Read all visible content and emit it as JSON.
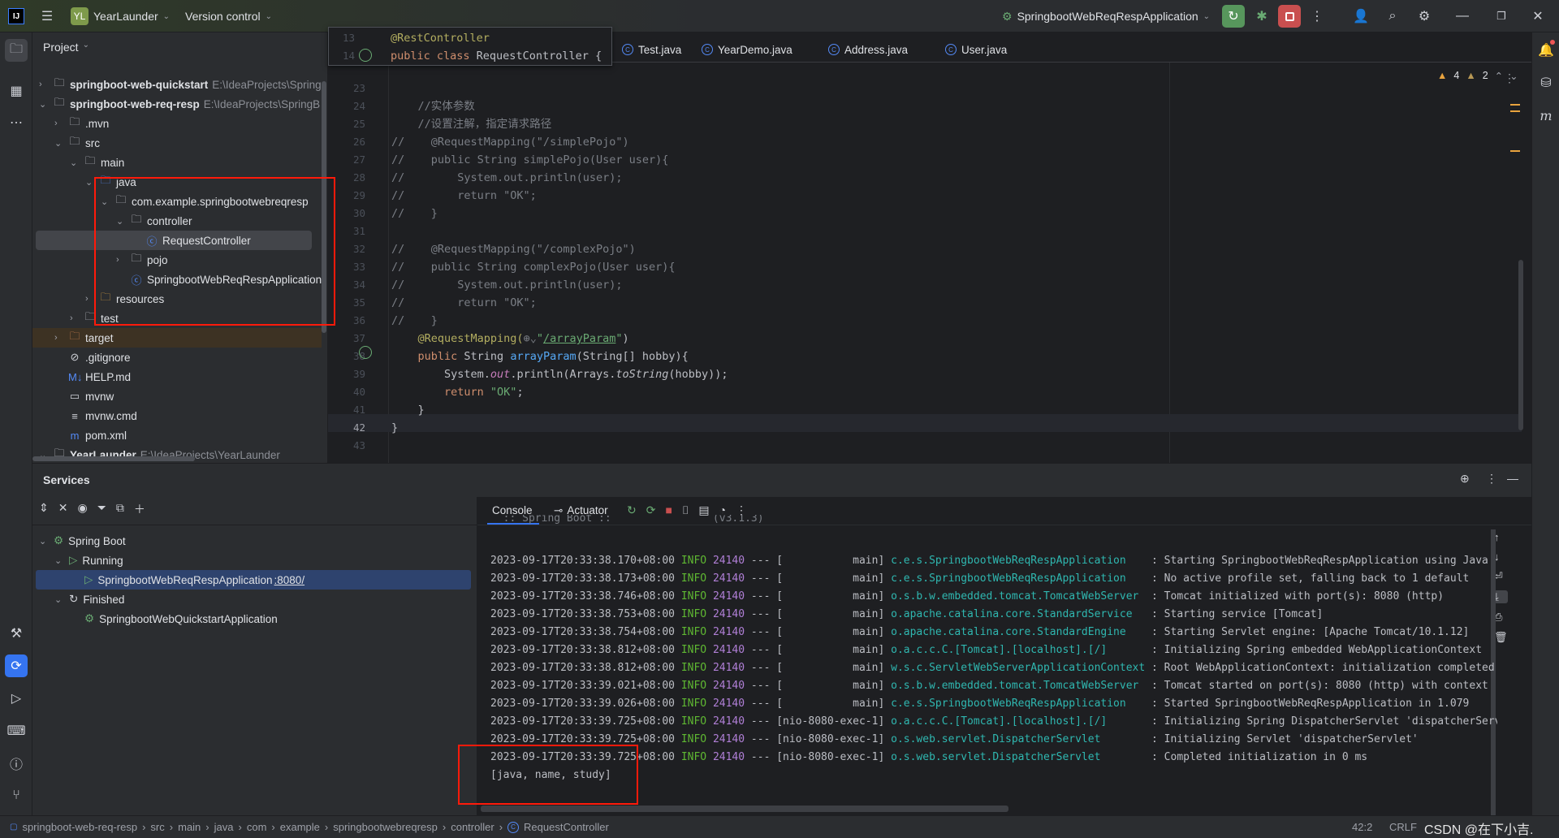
{
  "titlebar": {
    "project_badge": "YL",
    "project": "YearLaunder",
    "vcs": "Version control",
    "run_config": "SpringbootWebReqRespApplication"
  },
  "project_panel": {
    "title": "Project",
    "items": [
      {
        "label": "springboot-web-quickstart",
        "hint": "E:\\IdeaProjects\\Spring",
        "depth": 0,
        "chev": "›",
        "icon": "module",
        "bold": true
      },
      {
        "label": "springboot-web-req-resp",
        "hint": "E:\\IdeaProjects\\SpringB",
        "depth": 0,
        "chev": "⌄",
        "icon": "module",
        "bold": true
      },
      {
        "label": ".mvn",
        "depth": 1,
        "chev": "›",
        "icon": "folder"
      },
      {
        "label": "src",
        "depth": 1,
        "chev": "⌄",
        "icon": "folder"
      },
      {
        "label": "main",
        "depth": 2,
        "chev": "⌄",
        "icon": "folder"
      },
      {
        "label": "java",
        "depth": 3,
        "chev": "⌄",
        "icon": "src-folder"
      },
      {
        "label": "com.example.springbootwebreqresp",
        "depth": 4,
        "chev": "⌄",
        "icon": "package"
      },
      {
        "label": "controller",
        "depth": 5,
        "chev": "⌄",
        "icon": "package"
      },
      {
        "label": "RequestController",
        "depth": 6,
        "chev": "",
        "icon": "class",
        "selected": true
      },
      {
        "label": "pojo",
        "depth": 5,
        "chev": "›",
        "icon": "package"
      },
      {
        "label": "SpringbootWebReqRespApplication",
        "depth": 5,
        "chev": "",
        "icon": "spring-class"
      },
      {
        "label": "resources",
        "depth": 3,
        "chev": "›",
        "icon": "res-folder"
      },
      {
        "label": "test",
        "depth": 2,
        "chev": "›",
        "icon": "folder"
      },
      {
        "label": "target",
        "depth": 1,
        "chev": "›",
        "icon": "excluded-folder",
        "excluded": true
      },
      {
        "label": ".gitignore",
        "depth": 1,
        "chev": "",
        "icon": "ignore-file"
      },
      {
        "label": "HELP.md",
        "depth": 1,
        "chev": "",
        "icon": "markdown-file"
      },
      {
        "label": "mvnw",
        "depth": 1,
        "chev": "",
        "icon": "shell-file"
      },
      {
        "label": "mvnw.cmd",
        "depth": 1,
        "chev": "",
        "icon": "text-file"
      },
      {
        "label": "pom.xml",
        "depth": 1,
        "chev": "",
        "icon": "maven-file"
      },
      {
        "label": "YearLaunder",
        "hint": "E:\\IdeaProjects\\YearLaunder",
        "depth": 0,
        "chev": "⌄",
        "icon": "module",
        "bold": true
      }
    ]
  },
  "editor": {
    "tabs": [
      "Test.java",
      "YearDemo.java",
      "Address.java",
      "User.java"
    ],
    "inspections": {
      "warnings": "4",
      "weak_warnings": "2"
    },
    "sticky": [
      {
        "n": "13",
        "tokens": [
          {
            "t": "@RestController",
            "c": "an"
          }
        ]
      },
      {
        "n": "14",
        "tokens": [
          {
            "t": "public class ",
            "c": "kw"
          },
          {
            "t": "RequestController ",
            "c": "tx"
          },
          {
            "t": "{",
            "c": "tx"
          }
        ]
      }
    ],
    "lines": [
      {
        "n": "23",
        "tokens": []
      },
      {
        "n": "24",
        "tokens": [
          {
            "t": "    //实体参数",
            "c": "cm"
          }
        ]
      },
      {
        "n": "25",
        "tokens": [
          {
            "t": "    //设置注解，指定请求路径",
            "c": "cm"
          }
        ]
      },
      {
        "n": "26",
        "tokens": [
          {
            "t": "//    @RequestMapping(\"/simplePojo\")",
            "c": "cm"
          }
        ]
      },
      {
        "n": "27",
        "tokens": [
          {
            "t": "//    public String simplePojo(User user){",
            "c": "cm"
          }
        ]
      },
      {
        "n": "28",
        "tokens": [
          {
            "t": "//        System.out.println(user);",
            "c": "cm"
          }
        ]
      },
      {
        "n": "29",
        "tokens": [
          {
            "t": "//        return \"OK\";",
            "c": "cm"
          }
        ]
      },
      {
        "n": "30",
        "tokens": [
          {
            "t": "//    }",
            "c": "cm"
          }
        ]
      },
      {
        "n": "31",
        "tokens": []
      },
      {
        "n": "32",
        "tokens": [
          {
            "t": "//    @RequestMapping(\"/complexPojo\")",
            "c": "cm"
          }
        ]
      },
      {
        "n": "33",
        "tokens": [
          {
            "t": "//    public String complexPojo(User user){",
            "c": "cm"
          }
        ]
      },
      {
        "n": "34",
        "tokens": [
          {
            "t": "//        System.out.println(user);",
            "c": "cm"
          }
        ]
      },
      {
        "n": "35",
        "tokens": [
          {
            "t": "//        return \"OK\";",
            "c": "cm"
          }
        ]
      },
      {
        "n": "36",
        "tokens": [
          {
            "t": "//    }",
            "c": "cm"
          }
        ]
      },
      {
        "n": "37",
        "tokens": [
          {
            "t": "    @RequestMapping(",
            "c": "an"
          },
          {
            "t": "⊕⌄",
            "c": "cm"
          },
          {
            "t": "\"",
            "c": "st"
          },
          {
            "t": "/arrayParam",
            "c": "ul"
          },
          {
            "t": "\"",
            "c": "st"
          },
          {
            "t": ")",
            "c": "tx"
          }
        ]
      },
      {
        "n": "38",
        "tokens": [
          {
            "t": "    public ",
            "c": "kw"
          },
          {
            "t": "String ",
            "c": "tx"
          },
          {
            "t": "arrayParam",
            "c": "fn"
          },
          {
            "t": "(String[] hobby){",
            "c": "tx"
          }
        ]
      },
      {
        "n": "39",
        "tokens": [
          {
            "t": "        System.",
            "c": "tx"
          },
          {
            "t": "out",
            "c": "it"
          },
          {
            "t": ".println(Arrays.",
            "c": "tx"
          },
          {
            "t": "toString",
            "c": "sti"
          },
          {
            "t": "(hobby));",
            "c": "tx"
          }
        ]
      },
      {
        "n": "40",
        "tokens": [
          {
            "t": "        return ",
            "c": "kw"
          },
          {
            "t": "\"OK\"",
            "c": "st"
          },
          {
            "t": ";",
            "c": "tx"
          }
        ]
      },
      {
        "n": "41",
        "tokens": [
          {
            "t": "    }",
            "c": "tx"
          }
        ]
      },
      {
        "n": "42",
        "tokens": [
          {
            "t": "}",
            "c": "tx"
          }
        ]
      },
      {
        "n": "43",
        "tokens": []
      }
    ]
  },
  "services": {
    "title": "Services",
    "tree": [
      {
        "label": "Spring Boot",
        "depth": 0,
        "chev": "⌄",
        "icon": "spring-boot"
      },
      {
        "label": "Running",
        "depth": 1,
        "chev": "⌄",
        "icon": "run"
      },
      {
        "label": "SpringbootWebReqRespApplication",
        "port": ":8080/",
        "depth": 2,
        "chev": "",
        "icon": "run",
        "selected": true
      },
      {
        "label": "Finished",
        "depth": 1,
        "chev": "⌄",
        "icon": "rerun"
      },
      {
        "label": "SpringbootWebQuickstartApplication",
        "depth": 2,
        "chev": "",
        "icon": "spring-boot"
      }
    ],
    "console_tabs": [
      "Console",
      "Actuator"
    ],
    "banner": "  :: Spring Boot ::                (v3.1.3)",
    "log": [
      [
        "2023-09-17T20:33:38.170+08:00",
        "INFO",
        "24140",
        "--- [           main]",
        "c.e.s.SpringbootWebReqRespApplication   ",
        ": Starting SpringbootWebReqRespApplication using Java"
      ],
      [
        "2023-09-17T20:33:38.173+08:00",
        "INFO",
        "24140",
        "--- [           main]",
        "c.e.s.SpringbootWebReqRespApplication   ",
        ": No active profile set, falling back to 1 default"
      ],
      [
        "2023-09-17T20:33:38.746+08:00",
        "INFO",
        "24140",
        "--- [           main]",
        "o.s.b.w.embedded.tomcat.TomcatWebServer ",
        ": Tomcat initialized with port(s): 8080 (http)"
      ],
      [
        "2023-09-17T20:33:38.753+08:00",
        "INFO",
        "24140",
        "--- [           main]",
        "o.apache.catalina.core.StandardService  ",
        ": Starting service [Tomcat]"
      ],
      [
        "2023-09-17T20:33:38.754+08:00",
        "INFO",
        "24140",
        "--- [           main]",
        "o.apache.catalina.core.StandardEngine   ",
        ": Starting Servlet engine: [Apache Tomcat/10.1.12]"
      ],
      [
        "2023-09-17T20:33:38.812+08:00",
        "INFO",
        "24140",
        "--- [           main]",
        "o.a.c.c.C.[Tomcat].[localhost].[/]      ",
        ": Initializing Spring embedded WebApplicationContext"
      ],
      [
        "2023-09-17T20:33:38.812+08:00",
        "INFO",
        "24140",
        "--- [           main]",
        "w.s.c.ServletWebServerApplicationContext",
        ": Root WebApplicationContext: initialization completed"
      ],
      [
        "2023-09-17T20:33:39.021+08:00",
        "INFO",
        "24140",
        "--- [           main]",
        "o.s.b.w.embedded.tomcat.TomcatWebServer ",
        ": Tomcat started on port(s): 8080 (http) with context"
      ],
      [
        "2023-09-17T20:33:39.026+08:00",
        "INFO",
        "24140",
        "--- [           main]",
        "c.e.s.SpringbootWebReqRespApplication   ",
        ": Started SpringbootWebReqRespApplication in 1.079"
      ],
      [
        "2023-09-17T20:33:39.725+08:00",
        "INFO",
        "24140",
        "--- [nio-8080-exec-1]",
        "o.a.c.c.C.[Tomcat].[localhost].[/]      ",
        ": Initializing Spring DispatcherServlet 'dispatcherServlet'"
      ],
      [
        "2023-09-17T20:33:39.725+08:00",
        "INFO",
        "24140",
        "--- [nio-8080-exec-1]",
        "o.s.web.servlet.DispatcherServlet       ",
        ": Initializing Servlet 'dispatcherServlet'"
      ],
      [
        "2023-09-17T20:33:39.725+08:00",
        "INFO",
        "24140",
        "--- [nio-8080-exec-1]",
        "o.s.web.servlet.DispatcherServlet       ",
        ": Completed initialization in 0 ms"
      ]
    ],
    "output": "[java, name, study]"
  },
  "statusbar": {
    "breadcrumbs": [
      "springboot-web-req-resp",
      "src",
      "main",
      "java",
      "com",
      "example",
      "springbootwebreqresp",
      "controller",
      "RequestController"
    ],
    "position": "42:2",
    "line_sep": "CRLF",
    "watermark": "CSDN @在下小吉."
  },
  "colors": {
    "accent": "#3574f0",
    "run_green": "#57965c",
    "stop_red": "#c94f4f",
    "highlight_box": "#ff1a0a"
  }
}
